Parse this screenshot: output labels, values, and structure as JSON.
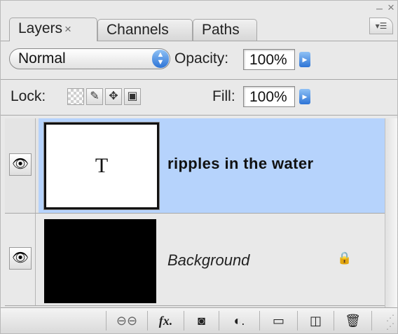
{
  "panel": {
    "tabs": [
      {
        "label": "Layers",
        "close": "×"
      },
      {
        "label": "Channels"
      },
      {
        "label": "Paths"
      }
    ],
    "window_controls": {
      "minimize": "–",
      "close": "×"
    },
    "menu_icon": "panel-menu-icon"
  },
  "blend": {
    "mode": "Normal",
    "opacity_label": "Opacity:",
    "opacity_value": "100%"
  },
  "lock": {
    "label": "Lock:",
    "icons": [
      "lock-transparent-pixels-icon",
      "lock-image-pixels-icon",
      "lock-position-icon",
      "lock-all-icon"
    ],
    "fill_label": "Fill:",
    "fill_value": "100%"
  },
  "layers": [
    {
      "name": "ripples in the water",
      "thumbnail_text": "T",
      "type": "text",
      "selected": true,
      "visible": true
    },
    {
      "name": "Background",
      "type": "background",
      "locked": true,
      "visible": true
    }
  ],
  "toolbar": {
    "icons": [
      "link-layers-icon",
      "layer-style-fx-icon",
      "add-mask-icon",
      "adjustment-layer-icon",
      "new-group-icon",
      "new-layer-icon",
      "delete-layer-icon"
    ],
    "fx_label": "fx"
  },
  "colors": {
    "selection": "#b6d3fc",
    "panel_bg": "#e9e9e9",
    "accent_blue": "#2d74d6"
  }
}
